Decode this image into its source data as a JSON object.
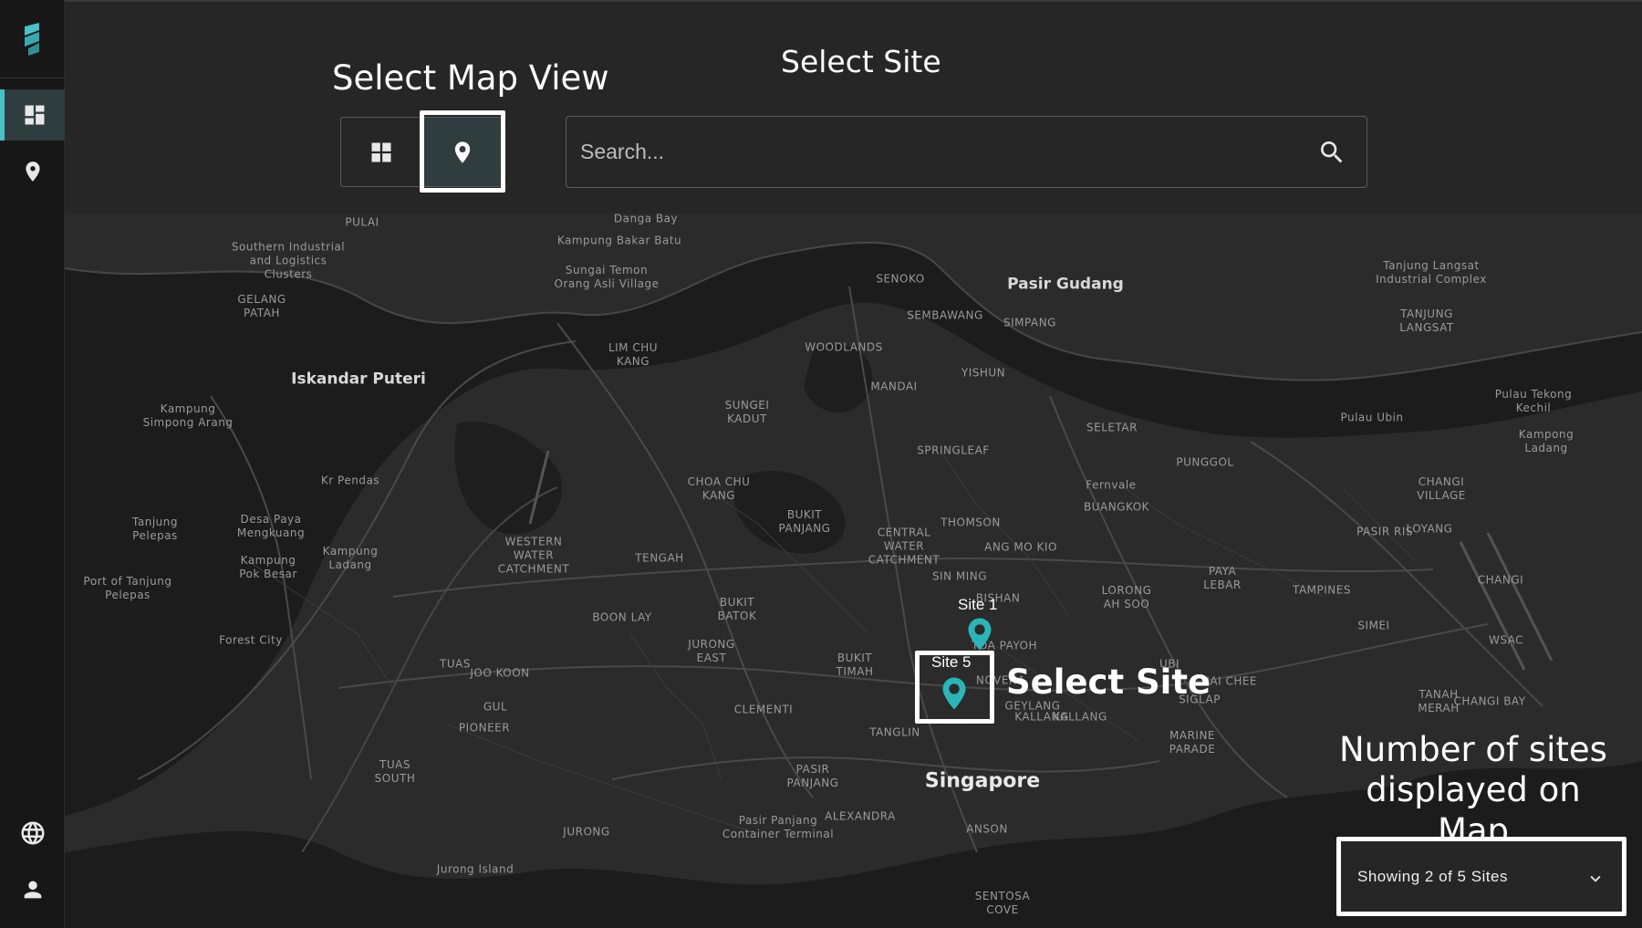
{
  "sidebar": {
    "logo": "brand-logo",
    "items": [
      {
        "icon": "dashboard-icon",
        "active": true
      },
      {
        "icon": "location-pin-icon",
        "active": false
      },
      {
        "icon": "globe-icon",
        "active": false
      },
      {
        "icon": "user-icon",
        "active": false
      }
    ]
  },
  "header": {
    "map_view_annotation": "Select Map View",
    "select_site_annotation": "Select Site",
    "view_toggle": {
      "grid_icon": "grid-view-icon",
      "map_icon": "map-pin-icon",
      "selected": "map"
    },
    "search": {
      "placeholder": "Search...",
      "value": "",
      "icon": "search-icon"
    }
  },
  "map": {
    "labels_large": [
      {
        "text": "Iskandar Puteri"
      },
      {
        "text": "Pasir Gudang"
      }
    ],
    "label_city": "Singapore",
    "labels": [
      "PULAI",
      "Danga Bay",
      "Kampung Bakar Batu",
      "Southern Industrial\nand Logistics\nClusters",
      "Sungai Temon\nOrang Asli Village",
      "GELANG\nPATAH",
      "SENOKO",
      "SEMBAWANG",
      "SIMPANG",
      "Tanjung Langsat\nIndustrial Complex",
      "TANJUNG\nLANGSAT",
      "LIM CHU\nKANG",
      "WOODLANDS",
      "MANDAI",
      "YISHUN",
      "Kampung\nSimpong Arang",
      "SUNGEI\nKADUT",
      "SELETAR",
      "Pulau Tekong\nKechil",
      "Pulau Ubin",
      "Kampong\nLadang",
      "SPRINGLEAF",
      "PUNGGOL",
      "Kr Pendas",
      "CHOA CHU\nKANG",
      "Fernvale",
      "CHANGI\nVILLAGE",
      "BUANGKOK",
      "Tanjung\nPelepas",
      "Desa Paya\nMengkuang",
      "BUKIT\nPANJANG",
      "THOMSON",
      "CENTRAL\nWATER\nCATCHMENT",
      "WESTERN\nWATER\nCATCHMENT",
      "TENGAH",
      "ANG MO KIO",
      "PASIR RIS",
      "LOYANG",
      "Kampung\nLadang",
      "Kampung\nPok Besar",
      "SIN MING",
      "PAYA\nLEBAR",
      "TAMPINES",
      "CHANGI",
      "Port of Tanjung\nPelepas",
      "LORONG\nAH SOO",
      "BOON LAY",
      "BUKIT\nBATOK",
      "SIMEI",
      "WSAC",
      "Forest City",
      "JURONG\nEAST",
      "BUKIT\nTIMAH",
      "UBI",
      "TUAS",
      "JOO KOON",
      "KALLANG",
      "GUL",
      "CLEMENTI",
      "MARINE\nPARADE",
      "TANAH\nMERAH",
      "CHANGI BAY",
      "PIONEER",
      "TANGLIN",
      "TUAS\nSOUTH",
      "PASIR\nPANJANG",
      "ALEXANDRA",
      "JURONG",
      "Pasir Panjang\nContainer Terminal",
      "ANSON",
      "Jurong Island",
      "SENTOSA\nCOVE",
      "BISHAN",
      "TOA PAYOH",
      "NOVENA",
      "KALLANG",
      "GEYLANG",
      "SIGLAP",
      "CHAI CHEE"
    ],
    "sites": [
      {
        "name": "Site 1",
        "color": "#2bb5b8"
      },
      {
        "name": "Site 5",
        "color": "#2bb5b8"
      }
    ],
    "select_site_annotation": "Select Site",
    "count_annotation": "Number of sites\ndisplayed on Map",
    "count_select": {
      "value": "Showing 2 of 5 Sites",
      "icon": "chevron-down-icon"
    }
  },
  "colors": {
    "accent": "#49c1c6",
    "marker": "#2bb5b8",
    "land": "#2b2b2b",
    "water": "#1a1a1a"
  }
}
